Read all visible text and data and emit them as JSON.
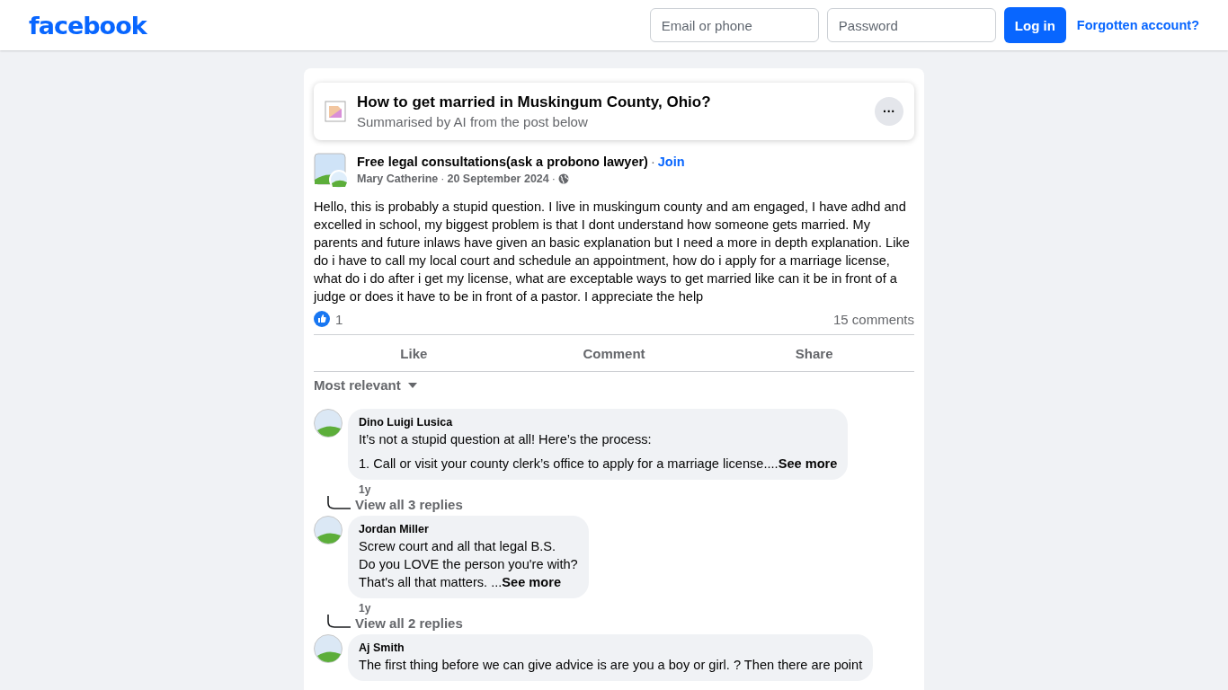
{
  "header": {
    "logo": "facebook",
    "email": {
      "placeholder": "Email or phone"
    },
    "password": {
      "placeholder": "Password"
    },
    "login": "Log in",
    "forgot": "Forgotten account?"
  },
  "summary": {
    "title": "How to get married in Muskingum County, Ohio?",
    "subtitle": "Summarised by AI from the post below",
    "more": "···"
  },
  "post": {
    "group": "Free legal consultations(ask a probono lawyer)",
    "sep": "·",
    "join": "Join",
    "author": "Mary Catherine",
    "date": "20 September 2024",
    "body": "Hello, this is probably a stupid question. I live in muskingum county and am engaged, I have adhd and excelled in school, my biggest problem is that I dont understand how someone gets married. My parents and future inlaws have given an basic explanation but I need a more in depth explanation. Like do i have to call my local court and schedule an appointment, how do i apply for a marriage license, what do i do after i get my license, what are exceptable ways to get married like can it be in front of a judge or does it have to be in front of a pastor. I appreciate the help",
    "likes": "1",
    "comments": "15 comments",
    "actions": [
      "Like",
      "Comment",
      "Share"
    ]
  },
  "sort": "Most relevant",
  "comments": [
    {
      "name": "Dino Luigi Lusica",
      "paragraphs": [
        [
          "It’s not a stupid question at all! Here’s the process:"
        ],
        [
          "1. Call or visit your county clerk’s office to apply for a marriage license...."
        ]
      ],
      "see_more": "See more",
      "time": "1y",
      "replies": "View all 3 replies"
    },
    {
      "name": "Jordan Miller",
      "paragraphs": [
        [
          "Screw court and all that legal B.S.",
          "Do you LOVE the person you're with?",
          "That's all that matters. ..."
        ]
      ],
      "see_more": "See more",
      "time": "1y",
      "replies": "View all 2 replies"
    },
    {
      "name": "Aj Smith",
      "paragraphs": [
        [
          "The first thing before we can give advice is are you a boy or girl. ? Then there are point"
        ]
      ]
    }
  ]
}
